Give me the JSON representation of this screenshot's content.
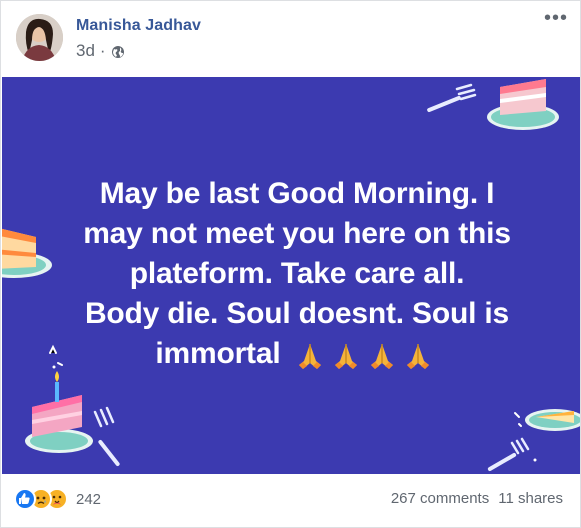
{
  "post": {
    "author": "Manisha Jadhav",
    "time": "3d",
    "time_separator": "·",
    "more_label": "•••",
    "message_lines": [
      "May be last Good Morning. I",
      "may not meet you here on this",
      "plateform. Take care all.",
      "Body die. Soul doesnt. Soul is",
      "immortal"
    ],
    "message_emoji": [
      "folded-hands-emoji",
      "folded-hands-emoji",
      "folded-hands-emoji",
      "folded-hands-emoji"
    ],
    "background_color": "#3c3ab0",
    "reaction_icons": [
      "like-icon",
      "sad-icon",
      "care-icon"
    ],
    "reaction_count": "242",
    "comments": "267 comments",
    "shares": "11 shares"
  },
  "colors": {
    "author": "#385898",
    "meta_text": "#606770",
    "like_blue": "#1877f2",
    "sad_yellow": "#f7b125"
  },
  "icons": {
    "globe": "globe-icon",
    "more": "more-options-icon"
  }
}
